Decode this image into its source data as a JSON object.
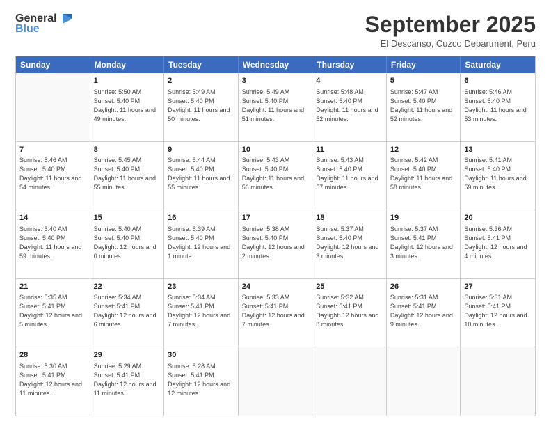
{
  "header": {
    "logo_line1": "General",
    "logo_line2": "Blue",
    "month_title": "September 2025",
    "location": "El Descanso, Cuzco Department, Peru"
  },
  "weekdays": [
    "Sunday",
    "Monday",
    "Tuesday",
    "Wednesday",
    "Thursday",
    "Friday",
    "Saturday"
  ],
  "rows": [
    [
      {
        "day": "",
        "sunrise": "",
        "sunset": "",
        "daylight": ""
      },
      {
        "day": "1",
        "sunrise": "Sunrise: 5:50 AM",
        "sunset": "Sunset: 5:40 PM",
        "daylight": "Daylight: 11 hours and 49 minutes."
      },
      {
        "day": "2",
        "sunrise": "Sunrise: 5:49 AM",
        "sunset": "Sunset: 5:40 PM",
        "daylight": "Daylight: 11 hours and 50 minutes."
      },
      {
        "day": "3",
        "sunrise": "Sunrise: 5:49 AM",
        "sunset": "Sunset: 5:40 PM",
        "daylight": "Daylight: 11 hours and 51 minutes."
      },
      {
        "day": "4",
        "sunrise": "Sunrise: 5:48 AM",
        "sunset": "Sunset: 5:40 PM",
        "daylight": "Daylight: 11 hours and 52 minutes."
      },
      {
        "day": "5",
        "sunrise": "Sunrise: 5:47 AM",
        "sunset": "Sunset: 5:40 PM",
        "daylight": "Daylight: 11 hours and 52 minutes."
      },
      {
        "day": "6",
        "sunrise": "Sunrise: 5:46 AM",
        "sunset": "Sunset: 5:40 PM",
        "daylight": "Daylight: 11 hours and 53 minutes."
      }
    ],
    [
      {
        "day": "7",
        "sunrise": "Sunrise: 5:46 AM",
        "sunset": "Sunset: 5:40 PM",
        "daylight": "Daylight: 11 hours and 54 minutes."
      },
      {
        "day": "8",
        "sunrise": "Sunrise: 5:45 AM",
        "sunset": "Sunset: 5:40 PM",
        "daylight": "Daylight: 11 hours and 55 minutes."
      },
      {
        "day": "9",
        "sunrise": "Sunrise: 5:44 AM",
        "sunset": "Sunset: 5:40 PM",
        "daylight": "Daylight: 11 hours and 55 minutes."
      },
      {
        "day": "10",
        "sunrise": "Sunrise: 5:43 AM",
        "sunset": "Sunset: 5:40 PM",
        "daylight": "Daylight: 11 hours and 56 minutes."
      },
      {
        "day": "11",
        "sunrise": "Sunrise: 5:43 AM",
        "sunset": "Sunset: 5:40 PM",
        "daylight": "Daylight: 11 hours and 57 minutes."
      },
      {
        "day": "12",
        "sunrise": "Sunrise: 5:42 AM",
        "sunset": "Sunset: 5:40 PM",
        "daylight": "Daylight: 11 hours and 58 minutes."
      },
      {
        "day": "13",
        "sunrise": "Sunrise: 5:41 AM",
        "sunset": "Sunset: 5:40 PM",
        "daylight": "Daylight: 11 hours and 59 minutes."
      }
    ],
    [
      {
        "day": "14",
        "sunrise": "Sunrise: 5:40 AM",
        "sunset": "Sunset: 5:40 PM",
        "daylight": "Daylight: 11 hours and 59 minutes."
      },
      {
        "day": "15",
        "sunrise": "Sunrise: 5:40 AM",
        "sunset": "Sunset: 5:40 PM",
        "daylight": "Daylight: 12 hours and 0 minutes."
      },
      {
        "day": "16",
        "sunrise": "Sunrise: 5:39 AM",
        "sunset": "Sunset: 5:40 PM",
        "daylight": "Daylight: 12 hours and 1 minute."
      },
      {
        "day": "17",
        "sunrise": "Sunrise: 5:38 AM",
        "sunset": "Sunset: 5:40 PM",
        "daylight": "Daylight: 12 hours and 2 minutes."
      },
      {
        "day": "18",
        "sunrise": "Sunrise: 5:37 AM",
        "sunset": "Sunset: 5:40 PM",
        "daylight": "Daylight: 12 hours and 3 minutes."
      },
      {
        "day": "19",
        "sunrise": "Sunrise: 5:37 AM",
        "sunset": "Sunset: 5:41 PM",
        "daylight": "Daylight: 12 hours and 3 minutes."
      },
      {
        "day": "20",
        "sunrise": "Sunrise: 5:36 AM",
        "sunset": "Sunset: 5:41 PM",
        "daylight": "Daylight: 12 hours and 4 minutes."
      }
    ],
    [
      {
        "day": "21",
        "sunrise": "Sunrise: 5:35 AM",
        "sunset": "Sunset: 5:41 PM",
        "daylight": "Daylight: 12 hours and 5 minutes."
      },
      {
        "day": "22",
        "sunrise": "Sunrise: 5:34 AM",
        "sunset": "Sunset: 5:41 PM",
        "daylight": "Daylight: 12 hours and 6 minutes."
      },
      {
        "day": "23",
        "sunrise": "Sunrise: 5:34 AM",
        "sunset": "Sunset: 5:41 PM",
        "daylight": "Daylight: 12 hours and 7 minutes."
      },
      {
        "day": "24",
        "sunrise": "Sunrise: 5:33 AM",
        "sunset": "Sunset: 5:41 PM",
        "daylight": "Daylight: 12 hours and 7 minutes."
      },
      {
        "day": "25",
        "sunrise": "Sunrise: 5:32 AM",
        "sunset": "Sunset: 5:41 PM",
        "daylight": "Daylight: 12 hours and 8 minutes."
      },
      {
        "day": "26",
        "sunrise": "Sunrise: 5:31 AM",
        "sunset": "Sunset: 5:41 PM",
        "daylight": "Daylight: 12 hours and 9 minutes."
      },
      {
        "day": "27",
        "sunrise": "Sunrise: 5:31 AM",
        "sunset": "Sunset: 5:41 PM",
        "daylight": "Daylight: 12 hours and 10 minutes."
      }
    ],
    [
      {
        "day": "28",
        "sunrise": "Sunrise: 5:30 AM",
        "sunset": "Sunset: 5:41 PM",
        "daylight": "Daylight: 12 hours and 11 minutes."
      },
      {
        "day": "29",
        "sunrise": "Sunrise: 5:29 AM",
        "sunset": "Sunset: 5:41 PM",
        "daylight": "Daylight: 12 hours and 11 minutes."
      },
      {
        "day": "30",
        "sunrise": "Sunrise: 5:28 AM",
        "sunset": "Sunset: 5:41 PM",
        "daylight": "Daylight: 12 hours and 12 minutes."
      },
      {
        "day": "",
        "sunrise": "",
        "sunset": "",
        "daylight": ""
      },
      {
        "day": "",
        "sunrise": "",
        "sunset": "",
        "daylight": ""
      },
      {
        "day": "",
        "sunrise": "",
        "sunset": "",
        "daylight": ""
      },
      {
        "day": "",
        "sunrise": "",
        "sunset": "",
        "daylight": ""
      }
    ]
  ]
}
